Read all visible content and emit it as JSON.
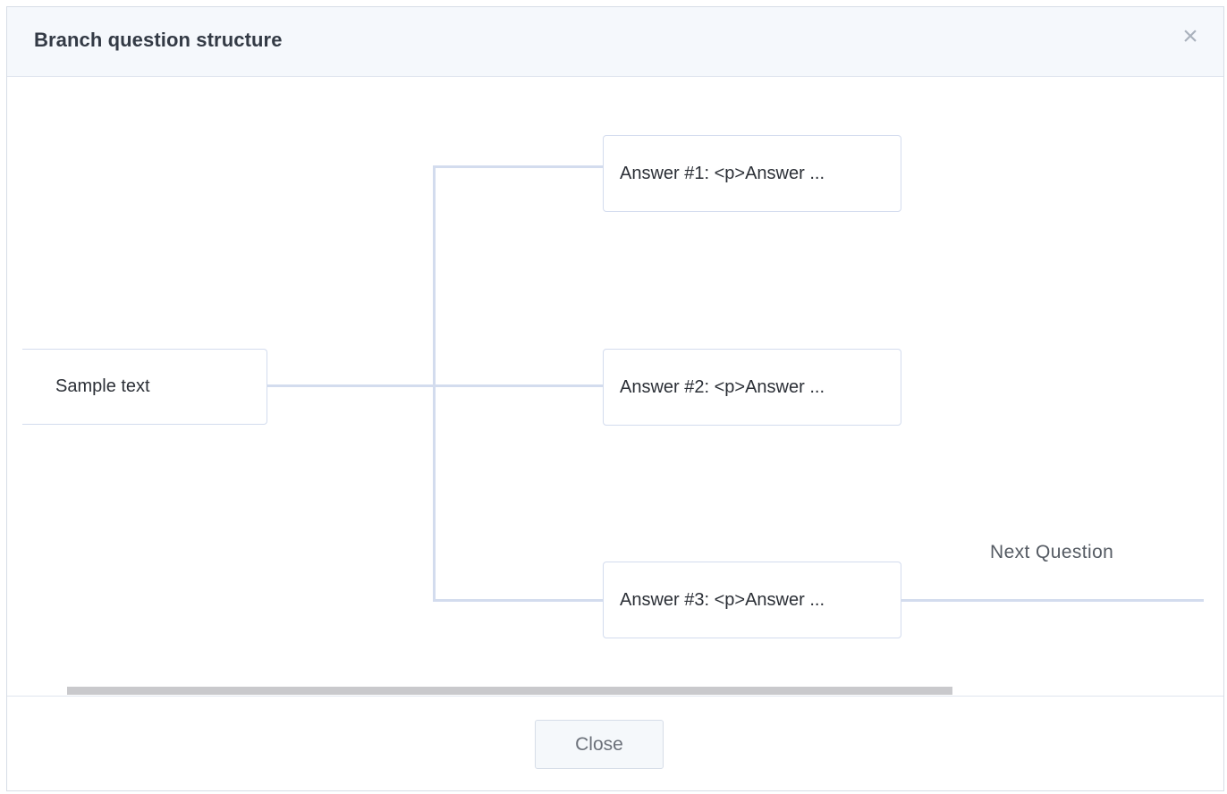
{
  "dialog": {
    "title": "Branch question structure",
    "close_icon": "close-icon",
    "close_glyph": "×"
  },
  "tree": {
    "question": "Sample text",
    "answers": [
      "Answer #1: <p>Answer ...",
      "Answer #2: <p>Answer ...",
      "Answer #3: <p>Answer ..."
    ],
    "next_question_label": "Next Question"
  },
  "footer": {
    "close_label": "Close"
  },
  "colors": {
    "connector": "#d3dcee",
    "header_bg": "#f5f8fc",
    "scrollbar": "#c9c9cc"
  }
}
